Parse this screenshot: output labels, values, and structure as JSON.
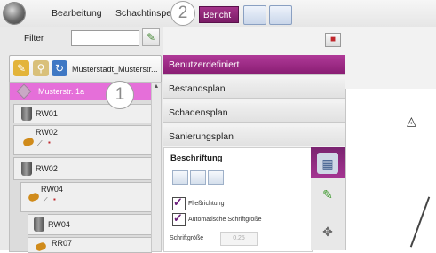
{
  "menu": {
    "items": [
      "Bearbeitung",
      "Schachtinspe"
    ],
    "report_tab": "Bericht",
    "callout_tabs": "2",
    "callout_tree": "1"
  },
  "filter": {
    "label": "Filter",
    "value": ""
  },
  "project": {
    "name": "Musterstadt_Musterstr..."
  },
  "tree": {
    "selected": "Musterstr. 1a",
    "nodes": [
      "RW01",
      "RW02",
      "RW02",
      "RW04",
      "RW04",
      "RR07"
    ]
  },
  "report_menu": {
    "items": [
      "Benutzerdefiniert",
      "Bestandsplan",
      "Schadensplan",
      "Sanierungsplan"
    ],
    "active_index": 0
  },
  "labeling": {
    "title": "Beschriftung",
    "checkbox_1": "Fließrichtung",
    "checkbox_2": "Automatische Schriftgröße",
    "font_size_label": "Schriftgröße",
    "font_size_value": "0.25"
  },
  "colors": {
    "accent": "#9b2a86",
    "selected_row": "#e56fd9"
  }
}
